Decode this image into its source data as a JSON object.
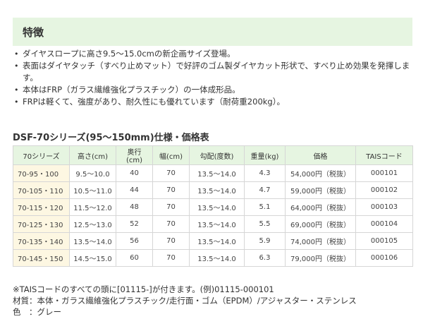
{
  "features": {
    "title": "特徴",
    "bullet": "•",
    "items": [
      "ダイヤスロープに高さ9.5～15.0cmの新企画サイズ登場。",
      "表面はダイヤタッチ（すべり止めマット）で好評のゴム製ダイヤカット形状で、すべり止め効果を発揮します。",
      "本体はFRP（ガラス繊維強化プラスチック）の一体成形品。",
      "FRPは軽くて、強度があり、耐久性にも優れています（耐荷重200kg）。"
    ]
  },
  "spec": {
    "title": "DSF-70シリーズ(95～150mm)仕様・価格表",
    "headers": [
      "70シリーズ",
      "高さ(cm)",
      "奥行(cm)",
      "幅(cm)",
      "勾配(度数)",
      "重量(kg)",
      "価格",
      "TAISコード"
    ],
    "rows": [
      [
        "70-95・100",
        "9.5～10.0",
        "40",
        "70",
        "13.5～14.0",
        "4.3",
        "54,000円（税抜）",
        "000101"
      ],
      [
        "70-105・110",
        "10.5～11.0",
        "44",
        "70",
        "13.5～14.0",
        "4.7",
        "59,000円（税抜）",
        "000102"
      ],
      [
        "70-115・120",
        "11.5～12.0",
        "48",
        "70",
        "13.5～14.0",
        "5.1",
        "64,000円（税抜）",
        "000103"
      ],
      [
        "70-125・130",
        "12.5～13.0",
        "52",
        "70",
        "13.5～14.0",
        "5.5",
        "69,000円（税抜）",
        "000104"
      ],
      [
        "70-135・140",
        "13.5～14.0",
        "56",
        "70",
        "13.5～14.0",
        "5.9",
        "74,000円（税抜）",
        "000105"
      ],
      [
        "70-145・150",
        "14.5～15.0",
        "60",
        "70",
        "13.5～14.0",
        "6.3",
        "79,000円（税抜）",
        "000106"
      ]
    ]
  },
  "notes": [
    "※TAISコードのすべての頭に[01115-]が付きます。(例)01115-000101",
    "材質：本体・ガラス繊維強化プラスチック/走行面・ゴム（EPDM）/アジャスター・ステンレス",
    "色　：グレー"
  ],
  "colors": {
    "header_bg": "#e6f5e1",
    "model_cell_bg": "#fdf7e2",
    "border": "#d6d6d6"
  }
}
